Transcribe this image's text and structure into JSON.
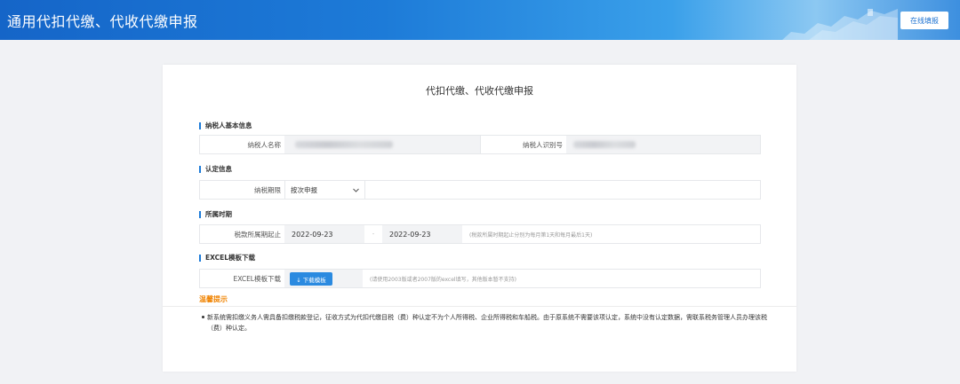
{
  "header": {
    "title": "通用代扣代缴、代收代缴申报",
    "online_button": "在线填报"
  },
  "card": {
    "title": "代扣代缴、代收代缴申报"
  },
  "taxpayer": {
    "section": "纳税人基本信息",
    "name_label": "纳税人名称",
    "name_value": "",
    "id_label": "纳税人识别号",
    "id_value": ""
  },
  "determination": {
    "section": "认定信息",
    "period_label": "纳税期限",
    "period_value": "按次申报"
  },
  "period": {
    "section": "所属时期",
    "label": "税款所属期起止",
    "start": "2022-09-23",
    "separator": "-",
    "end": "2022-09-23",
    "hint": "(税款所属时期起止分别为每月第1天和每月最后1天)"
  },
  "excel": {
    "section": "EXCEL模板下载",
    "label": "EXCEL模板下载",
    "button": "↓ 下载模板",
    "hint": "(请使用2003版或者2007版的excel填写，其他版本暂不支持)"
  },
  "tips": {
    "title": "温馨提示",
    "text": "新系统需扣缴义务人需具备扣缴税款登记，征收方式为代扣代缴目税（费）种认定不为个人所得税、企业所得税和车船税。由于原系统不需要该项认定，系统中没有认定数据，需联系税务管理人员办理该税（费）种认定。"
  },
  "colors": {
    "accent": "#1d7bd8",
    "warning": "#f08300"
  },
  "icons": {
    "select_arrow": "chevron-down-icon"
  }
}
